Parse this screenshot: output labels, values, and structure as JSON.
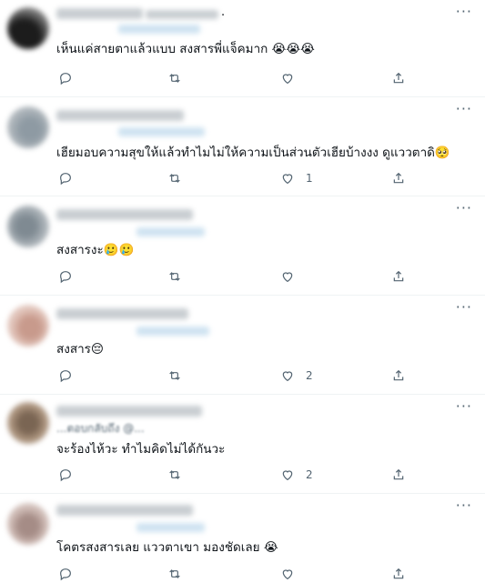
{
  "tweets": [
    {
      "text": "เห็นแค่สายตาแล้วแบบ สงสารพี่แจ็คมาก 😭😭😭",
      "like_count": "",
      "name_suffix": "."
    },
    {
      "text": "เฮียมอบความสุขให้แล้วทำไมไม่ให้ความเป็นส่วนตัวเฮียบ้างงง ดูแววตาดิ🥺",
      "like_count": "1"
    },
    {
      "text": "สงสารงะ🥲🥲",
      "like_count": ""
    },
    {
      "text": "สงสาร😔",
      "like_count": "2"
    },
    {
      "text": "จะร้องไห้วะ ทำไมคิดไม่ได้กันวะ",
      "like_count": "2",
      "reply_line": "...ตอบกลับถึง @..."
    },
    {
      "text": "โคตรสงสารเลย แววตาเขา มองชัดเลย 😭",
      "like_count": ""
    }
  ],
  "icons": {
    "reply": "reply-icon",
    "retweet": "retweet-icon",
    "like": "heart-icon",
    "share": "share-icon",
    "more": "more-icon"
  },
  "colors": {
    "icon": "#536471",
    "divider": "#eff3f4",
    "mention": "#1d9bf0"
  },
  "more_glyph": "···"
}
